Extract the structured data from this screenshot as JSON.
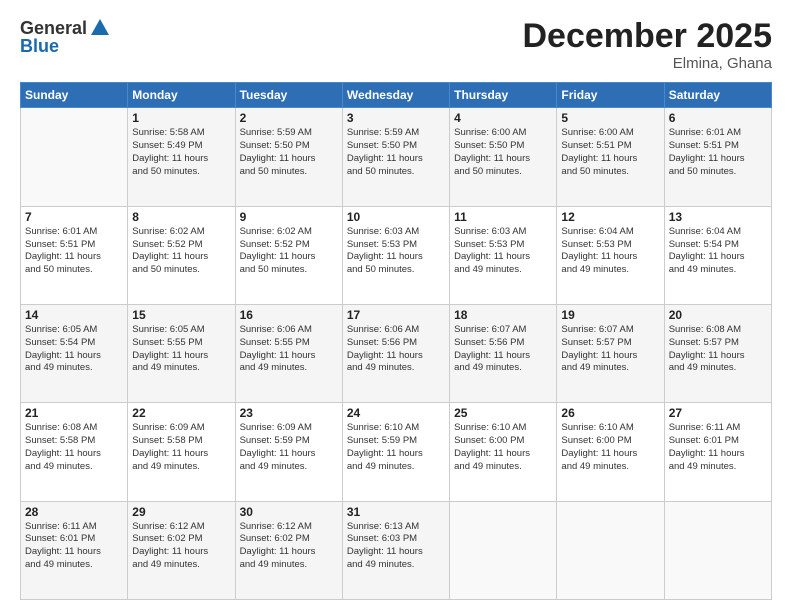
{
  "header": {
    "logo_general": "General",
    "logo_blue": "Blue",
    "month_title": "December 2025",
    "location": "Elmina, Ghana"
  },
  "days_of_week": [
    "Sunday",
    "Monday",
    "Tuesday",
    "Wednesday",
    "Thursday",
    "Friday",
    "Saturday"
  ],
  "weeks": [
    [
      {
        "day": "",
        "info": ""
      },
      {
        "day": "1",
        "info": "Sunrise: 5:58 AM\nSunset: 5:49 PM\nDaylight: 11 hours\nand 50 minutes."
      },
      {
        "day": "2",
        "info": "Sunrise: 5:59 AM\nSunset: 5:50 PM\nDaylight: 11 hours\nand 50 minutes."
      },
      {
        "day": "3",
        "info": "Sunrise: 5:59 AM\nSunset: 5:50 PM\nDaylight: 11 hours\nand 50 minutes."
      },
      {
        "day": "4",
        "info": "Sunrise: 6:00 AM\nSunset: 5:50 PM\nDaylight: 11 hours\nand 50 minutes."
      },
      {
        "day": "5",
        "info": "Sunrise: 6:00 AM\nSunset: 5:51 PM\nDaylight: 11 hours\nand 50 minutes."
      },
      {
        "day": "6",
        "info": "Sunrise: 6:01 AM\nSunset: 5:51 PM\nDaylight: 11 hours\nand 50 minutes."
      }
    ],
    [
      {
        "day": "7",
        "info": "Sunrise: 6:01 AM\nSunset: 5:51 PM\nDaylight: 11 hours\nand 50 minutes."
      },
      {
        "day": "8",
        "info": "Sunrise: 6:02 AM\nSunset: 5:52 PM\nDaylight: 11 hours\nand 50 minutes."
      },
      {
        "day": "9",
        "info": "Sunrise: 6:02 AM\nSunset: 5:52 PM\nDaylight: 11 hours\nand 50 minutes."
      },
      {
        "day": "10",
        "info": "Sunrise: 6:03 AM\nSunset: 5:53 PM\nDaylight: 11 hours\nand 50 minutes."
      },
      {
        "day": "11",
        "info": "Sunrise: 6:03 AM\nSunset: 5:53 PM\nDaylight: 11 hours\nand 49 minutes."
      },
      {
        "day": "12",
        "info": "Sunrise: 6:04 AM\nSunset: 5:53 PM\nDaylight: 11 hours\nand 49 minutes."
      },
      {
        "day": "13",
        "info": "Sunrise: 6:04 AM\nSunset: 5:54 PM\nDaylight: 11 hours\nand 49 minutes."
      }
    ],
    [
      {
        "day": "14",
        "info": "Sunrise: 6:05 AM\nSunset: 5:54 PM\nDaylight: 11 hours\nand 49 minutes."
      },
      {
        "day": "15",
        "info": "Sunrise: 6:05 AM\nSunset: 5:55 PM\nDaylight: 11 hours\nand 49 minutes."
      },
      {
        "day": "16",
        "info": "Sunrise: 6:06 AM\nSunset: 5:55 PM\nDaylight: 11 hours\nand 49 minutes."
      },
      {
        "day": "17",
        "info": "Sunrise: 6:06 AM\nSunset: 5:56 PM\nDaylight: 11 hours\nand 49 minutes."
      },
      {
        "day": "18",
        "info": "Sunrise: 6:07 AM\nSunset: 5:56 PM\nDaylight: 11 hours\nand 49 minutes."
      },
      {
        "day": "19",
        "info": "Sunrise: 6:07 AM\nSunset: 5:57 PM\nDaylight: 11 hours\nand 49 minutes."
      },
      {
        "day": "20",
        "info": "Sunrise: 6:08 AM\nSunset: 5:57 PM\nDaylight: 11 hours\nand 49 minutes."
      }
    ],
    [
      {
        "day": "21",
        "info": "Sunrise: 6:08 AM\nSunset: 5:58 PM\nDaylight: 11 hours\nand 49 minutes."
      },
      {
        "day": "22",
        "info": "Sunrise: 6:09 AM\nSunset: 5:58 PM\nDaylight: 11 hours\nand 49 minutes."
      },
      {
        "day": "23",
        "info": "Sunrise: 6:09 AM\nSunset: 5:59 PM\nDaylight: 11 hours\nand 49 minutes."
      },
      {
        "day": "24",
        "info": "Sunrise: 6:10 AM\nSunset: 5:59 PM\nDaylight: 11 hours\nand 49 minutes."
      },
      {
        "day": "25",
        "info": "Sunrise: 6:10 AM\nSunset: 6:00 PM\nDaylight: 11 hours\nand 49 minutes."
      },
      {
        "day": "26",
        "info": "Sunrise: 6:10 AM\nSunset: 6:00 PM\nDaylight: 11 hours\nand 49 minutes."
      },
      {
        "day": "27",
        "info": "Sunrise: 6:11 AM\nSunset: 6:01 PM\nDaylight: 11 hours\nand 49 minutes."
      }
    ],
    [
      {
        "day": "28",
        "info": "Sunrise: 6:11 AM\nSunset: 6:01 PM\nDaylight: 11 hours\nand 49 minutes."
      },
      {
        "day": "29",
        "info": "Sunrise: 6:12 AM\nSunset: 6:02 PM\nDaylight: 11 hours\nand 49 minutes."
      },
      {
        "day": "30",
        "info": "Sunrise: 6:12 AM\nSunset: 6:02 PM\nDaylight: 11 hours\nand 49 minutes."
      },
      {
        "day": "31",
        "info": "Sunrise: 6:13 AM\nSunset: 6:03 PM\nDaylight: 11 hours\nand 49 minutes."
      },
      {
        "day": "",
        "info": ""
      },
      {
        "day": "",
        "info": ""
      },
      {
        "day": "",
        "info": ""
      }
    ]
  ]
}
